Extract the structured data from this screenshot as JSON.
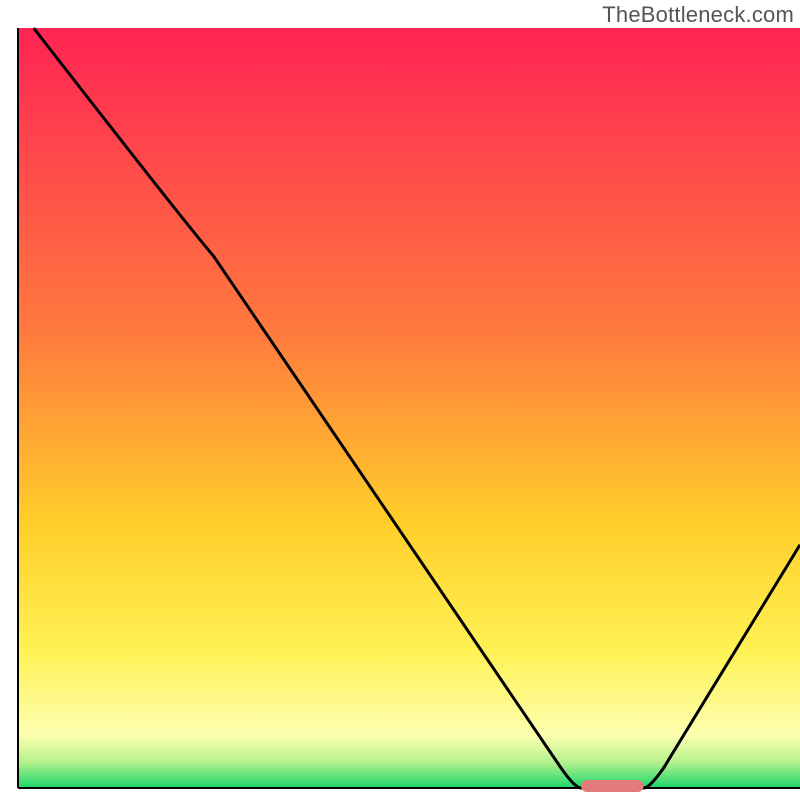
{
  "watermark": "TheBottleneck.com",
  "chart_data": {
    "type": "line",
    "title": "",
    "xlabel": "",
    "ylabel": "",
    "xlim": [
      0,
      100
    ],
    "ylim": [
      0,
      100
    ],
    "grid": false,
    "legend": false,
    "x": [
      2,
      25,
      72,
      80,
      100
    ],
    "values": [
      100,
      70,
      0,
      0,
      32
    ],
    "optimal_marker": {
      "x_start": 72,
      "x_end": 80,
      "color": "#e47a7a"
    },
    "background_gradient": {
      "stops": [
        {
          "offset": 0.0,
          "color": "#ff2454"
        },
        {
          "offset": 0.4,
          "color": "#ff7a3e"
        },
        {
          "offset": 0.65,
          "color": "#ffce2a"
        },
        {
          "offset": 0.82,
          "color": "#fff254"
        },
        {
          "offset": 0.93,
          "color": "#fdffb0"
        },
        {
          "offset": 0.965,
          "color": "#b8f28e"
        },
        {
          "offset": 1.0,
          "color": "#1ad66a"
        }
      ]
    }
  }
}
